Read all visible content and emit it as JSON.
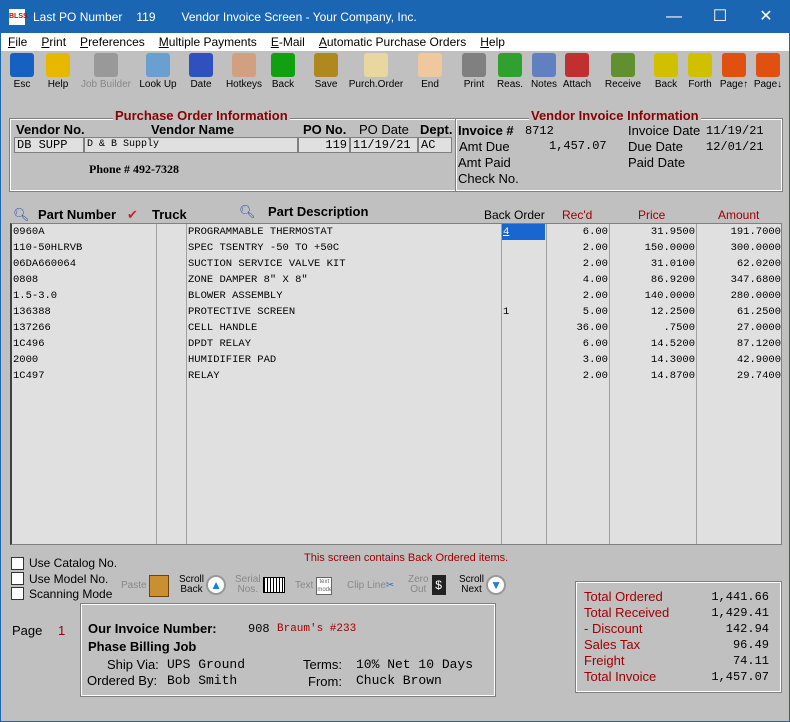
{
  "window": {
    "title_parts": [
      "Last PO Number",
      "119",
      "Vendor Invoice Screen - Your Company, Inc."
    ],
    "logo": "BLSS"
  },
  "menu": [
    "File",
    "Print",
    "Preferences",
    "Multiple Payments",
    "E-Mail",
    "Automatic Purchase Orders",
    "Help"
  ],
  "toolbar": [
    {
      "label": "Esc",
      "icon": "door-exit-icon",
      "color": "#1560c0"
    },
    {
      "label": "Help",
      "icon": "help-book-icon",
      "color": "#e8b800"
    },
    {
      "label": "Job Builder",
      "icon": "job-builder-icon",
      "color": "#999999",
      "disabled": true
    },
    {
      "label": "Look Up",
      "icon": "magnifier-icon",
      "color": "#6aa0d0"
    },
    {
      "label": "Date",
      "icon": "calendar-clock-icon",
      "color": "#3050c0"
    },
    {
      "label": "Hotkeys",
      "icon": "hand-keys-icon",
      "color": "#d0a080"
    },
    {
      "label": "Back",
      "icon": "back-arrow-icon",
      "color": "#10a010"
    },
    {
      "label": "Save",
      "icon": "safe-icon",
      "color": "#b08820"
    },
    {
      "label": "Purch.Order",
      "icon": "purchase-order-icon",
      "color": "#e8d8a0"
    },
    {
      "label": "End",
      "icon": "end-icon",
      "color": "#f0c8a0"
    },
    {
      "label": "Print",
      "icon": "printer-icon",
      "color": "#808080"
    },
    {
      "label": "Reas.",
      "icon": "reassign-icon",
      "color": "#30a030"
    },
    {
      "label": "Notes",
      "icon": "notes-icon",
      "color": "#6080c0"
    },
    {
      "label": "Attach",
      "icon": "paperclip-icon",
      "color": "#c03030"
    },
    {
      "label": "Receive",
      "icon": "receive-icon",
      "color": "#609030"
    },
    {
      "label": "Back",
      "icon": "sort-back-icon",
      "color": "#d0c000"
    },
    {
      "label": "Forth",
      "icon": "sort-forth-icon",
      "color": "#d0c000"
    },
    {
      "label": "Page↑",
      "icon": "page-up-icon",
      "color": "#e05010"
    },
    {
      "label": "Page↓",
      "icon": "page-down-icon",
      "color": "#e05010"
    }
  ],
  "po_info": {
    "title": "Purchase Order Information",
    "vendor_no_label": "Vendor No.",
    "vendor_name_label": "Vendor Name",
    "po_no_label": "PO No.",
    "po_date_label": "PO Date",
    "dept_label": "Dept.",
    "vendor_no": "DB SUPP",
    "vendor_name": "D & B Supply",
    "po_no": "119",
    "po_date": "11/19/21",
    "dept": "AC",
    "phone": "Phone # 492-7328"
  },
  "vendor_invoice": {
    "title": "Vendor Invoice Information",
    "invoice_label": "Invoice #",
    "invoice_no": "8712",
    "amt_due_label": "Amt Due",
    "amt_due": "1,457.07",
    "amt_paid_label": "Amt Paid",
    "check_no_label": "Check No.",
    "invoice_date_label": "Invoice Date",
    "invoice_date": "11/19/21",
    "due_date_label": "Due Date",
    "due_date": "12/01/21",
    "paid_date_label": "Paid Date"
  },
  "table": {
    "headers": {
      "part": "Part Number",
      "truck": "Truck",
      "desc": "Part Description",
      "back_order": "Back Order",
      "recd": "Rec'd",
      "price": "Price",
      "amount": "Amount"
    },
    "rows": [
      {
        "part": "0960A",
        "desc": "PROGRAMMABLE THERMOSTAT",
        "bo": "4",
        "recd": "6.00",
        "price": "31.9500",
        "amount": "191.7000"
      },
      {
        "part": "110-50HLRVB",
        "desc": "SPEC TSENTRY -50 TO +50C",
        "bo": "",
        "recd": "2.00",
        "price": "150.0000",
        "amount": "300.0000"
      },
      {
        "part": "06DA660064",
        "desc": "SUCTION SERVICE VALVE KIT",
        "bo": "",
        "recd": "2.00",
        "price": "31.0100",
        "amount": "62.0200"
      },
      {
        "part": "0808",
        "desc": "ZONE DAMPER 8\" X 8\"",
        "bo": "",
        "recd": "4.00",
        "price": "86.9200",
        "amount": "347.6800"
      },
      {
        "part": "1.5-3.0",
        "desc": "BLOWER ASSEMBLY",
        "bo": "",
        "recd": "2.00",
        "price": "140.0000",
        "amount": "280.0000"
      },
      {
        "part": "136388",
        "desc": "PROTECTIVE SCREEN",
        "bo": "1",
        "recd": "5.00",
        "price": "12.2500",
        "amount": "61.2500"
      },
      {
        "part": "137266",
        "desc": "CELL HANDLE",
        "bo": "",
        "recd": "36.00",
        "price": ".7500",
        "amount": "27.0000"
      },
      {
        "part": "1C496",
        "desc": "DPDT RELAY",
        "bo": "",
        "recd": "6.00",
        "price": "14.5200",
        "amount": "87.1200"
      },
      {
        "part": "2000",
        "desc": "HUMIDIFIER PAD",
        "bo": "",
        "recd": "3.00",
        "price": "14.3000",
        "amount": "42.9000"
      },
      {
        "part": "1C497",
        "desc": "RELAY",
        "bo": "",
        "recd": "2.00",
        "price": "14.8700",
        "amount": "29.7400"
      }
    ]
  },
  "options": {
    "use_catalog": "Use Catalog No.",
    "use_model": "Use Model No.",
    "scanning": "Scanning Mode"
  },
  "notice": "This screen contains Back Ordered items.",
  "bottom_buttons": {
    "paste": "Paste",
    "scroll_back": [
      "Scroll",
      "Back"
    ],
    "serial": [
      "Serial",
      "Nos."
    ],
    "text": "Text",
    "text_icon": "text mode",
    "clip": "Clip Line",
    "zero": [
      "Zero",
      "Out"
    ],
    "scroll_next": [
      "Scroll",
      "Next"
    ]
  },
  "page": {
    "label": "Page",
    "value": "1"
  },
  "our_invoice": {
    "label": "Our Invoice Number:",
    "number": "908",
    "job_ref": "Braum's #233",
    "job_title": "Phase Billing Job",
    "ship_via_label": "Ship Via:",
    "ship_via": "UPS Ground",
    "terms_label": "Terms:",
    "terms": "10% Net 10 Days",
    "ordered_by_label": "Ordered By:",
    "ordered_by": "Bob Smith",
    "from_label": "From:",
    "from": "Chuck Brown"
  },
  "totals": [
    {
      "label": "Total Ordered",
      "value": "1,441.66"
    },
    {
      "label": "Total Received",
      "value": "1,429.41"
    },
    {
      "label": "- Discount",
      "value": "142.94"
    },
    {
      "label": "Sales Tax",
      "value": "96.49"
    },
    {
      "label": "Freight",
      "value": "74.11"
    },
    {
      "label": "Total Invoice",
      "value": "1,457.07"
    }
  ]
}
